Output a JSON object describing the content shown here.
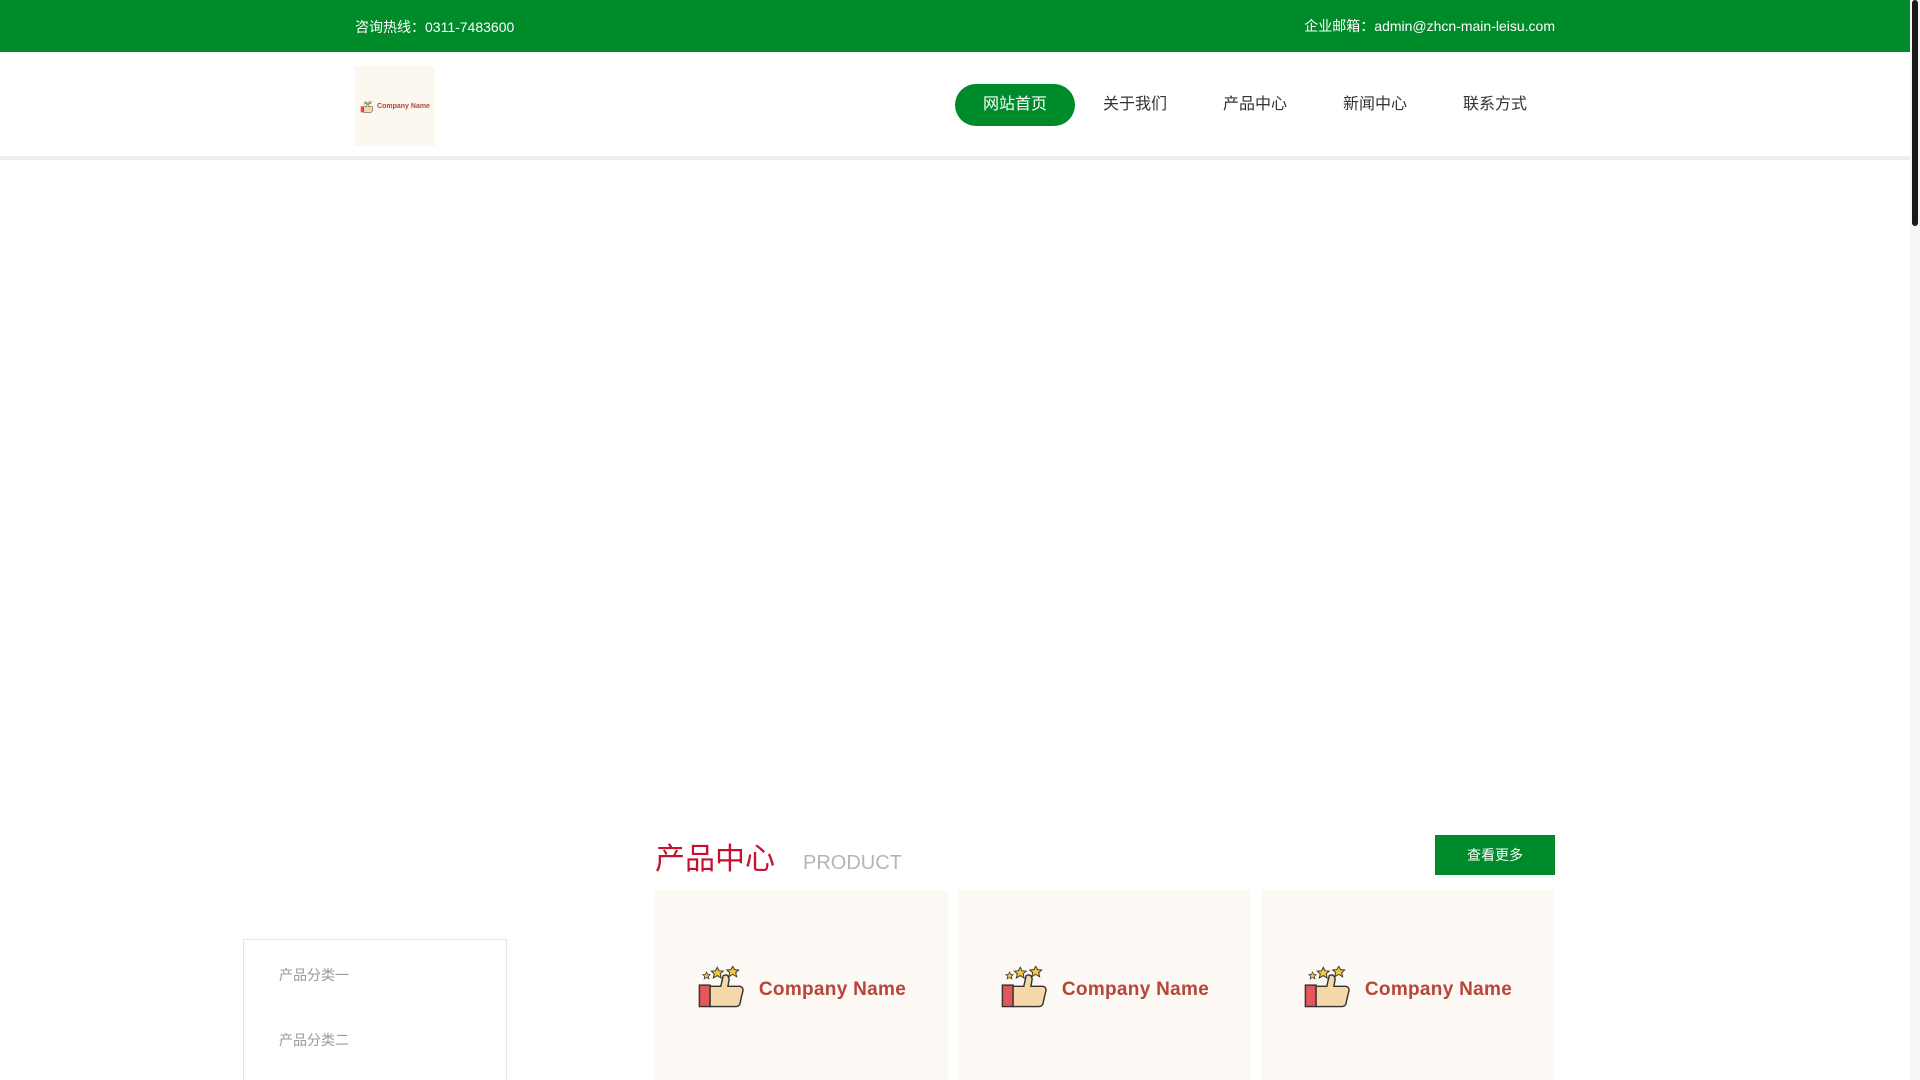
{
  "topbar": {
    "hotline": "咨询热线：0311-7483600",
    "email": "企业邮箱：admin@zhcn-main-leisu.com"
  },
  "logo": {
    "text": "Company Name"
  },
  "nav": {
    "items": [
      {
        "label": "网站首页",
        "active": true
      },
      {
        "label": "关于我们",
        "active": false
      },
      {
        "label": "产品中心",
        "active": false
      },
      {
        "label": "新闻中心",
        "active": false
      },
      {
        "label": "联系方式",
        "active": false
      }
    ]
  },
  "products_section": {
    "title_zh": "产品中心",
    "title_en": "PRODUCT",
    "more_label": "查看更多",
    "categories": [
      {
        "label": "产品分类一"
      },
      {
        "label": "产品分类二"
      }
    ],
    "cards": [
      {
        "name": "Company Name",
        "icon": "thumbs-up-stars-icon"
      },
      {
        "name": "Company Name",
        "icon": "thumbs-up-stars-icon"
      },
      {
        "name": "Company Name",
        "icon": "thumbs-up-stars-icon"
      }
    ]
  },
  "colors": {
    "primary_green": "#008b2b",
    "title_red": "#c8102e",
    "brand_red": "#b8443a",
    "card_bg": "#fcf8f3"
  }
}
